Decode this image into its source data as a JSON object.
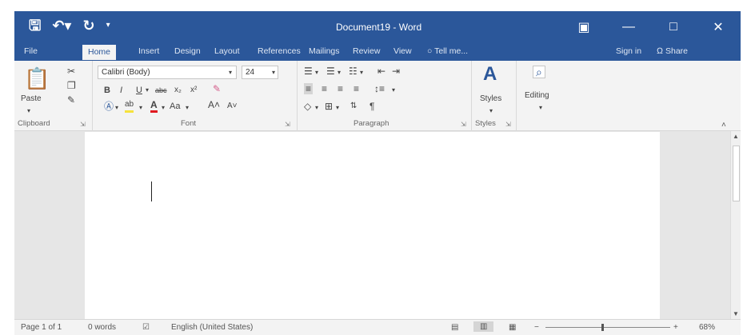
{
  "app": {
    "title": "Document19 - Word",
    "accent": "#2b579a"
  },
  "quick_access": {
    "save_icon": "save-icon",
    "undo_icon": "undo-icon",
    "redo_icon": "redo-icon",
    "customize_icon": "customize-qat-icon"
  },
  "tabs": [
    {
      "label": "File"
    },
    {
      "label": "Home"
    },
    {
      "label": "Insert"
    },
    {
      "label": "Design"
    },
    {
      "label": "Layout"
    },
    {
      "label": "References"
    },
    {
      "label": "Mailings"
    },
    {
      "label": "Review"
    },
    {
      "label": "View"
    }
  ],
  "tell_me": "Tell me...",
  "sign_in": "Sign in",
  "share": "Share",
  "ribbon": {
    "clipboard": {
      "paste": "Paste",
      "label": "Clipboard"
    },
    "font": {
      "name": "Calibri (Body)",
      "size": "24",
      "label": "Font",
      "change_case": "Aa"
    },
    "paragraph": {
      "label": "Paragraph"
    },
    "styles": {
      "button": "Styles",
      "label": "Styles"
    },
    "editing": {
      "button": "Editing"
    }
  },
  "status": {
    "page": "Page 1 of 1",
    "words": "0 words",
    "language": "English (United States)",
    "zoom": "68%"
  }
}
